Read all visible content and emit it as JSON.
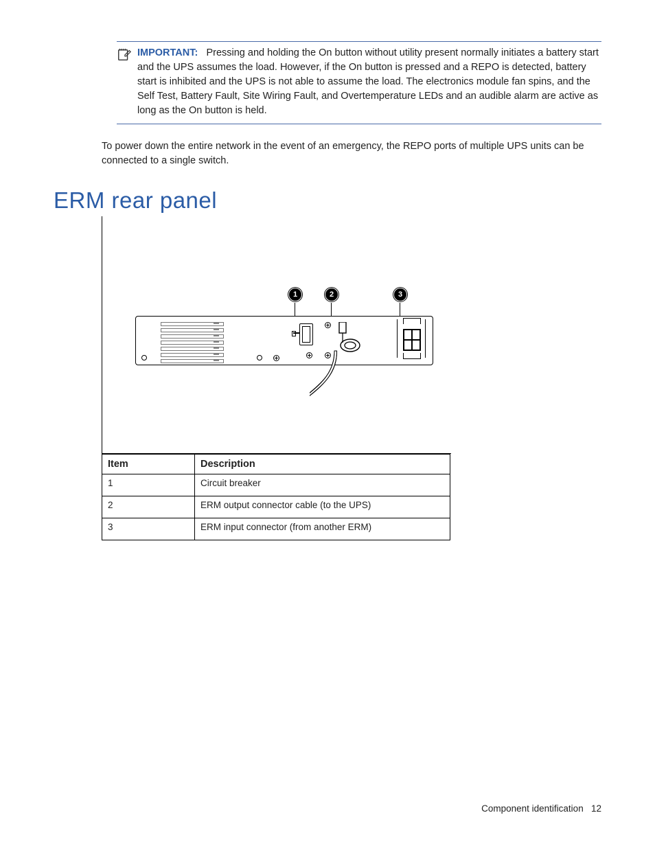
{
  "callout": {
    "important_label": "IMPORTANT:",
    "text": "Pressing and holding the On button without utility present normally initiates a battery start and the UPS assumes the load. However, if the On button is pressed and a REPO is detected, battery start is inhibited and the UPS is not able to assume the load. The electronics module fan spins, and the Self Test, Battery Fault, Site Wiring Fault, and Overtemperature LEDs and an audible alarm are active as long as the On button is held."
  },
  "body_paragraph": "To power down the entire network in the event of an emergency, the REPO ports of multiple UPS units can be connected to a single switch.",
  "section_heading": "ERM rear panel",
  "figure": {
    "markers": {
      "m1": "1",
      "m2": "2",
      "m3": "3"
    }
  },
  "table": {
    "headers": {
      "item": "Item",
      "description": "Description"
    },
    "rows": [
      {
        "item": "1",
        "desc": "Circuit breaker"
      },
      {
        "item": "2",
        "desc": "ERM output connector cable (to the UPS)"
      },
      {
        "item": "3",
        "desc": "ERM input connector (from another ERM)"
      }
    ]
  },
  "footer": {
    "section": "Component identification",
    "page": "12"
  }
}
